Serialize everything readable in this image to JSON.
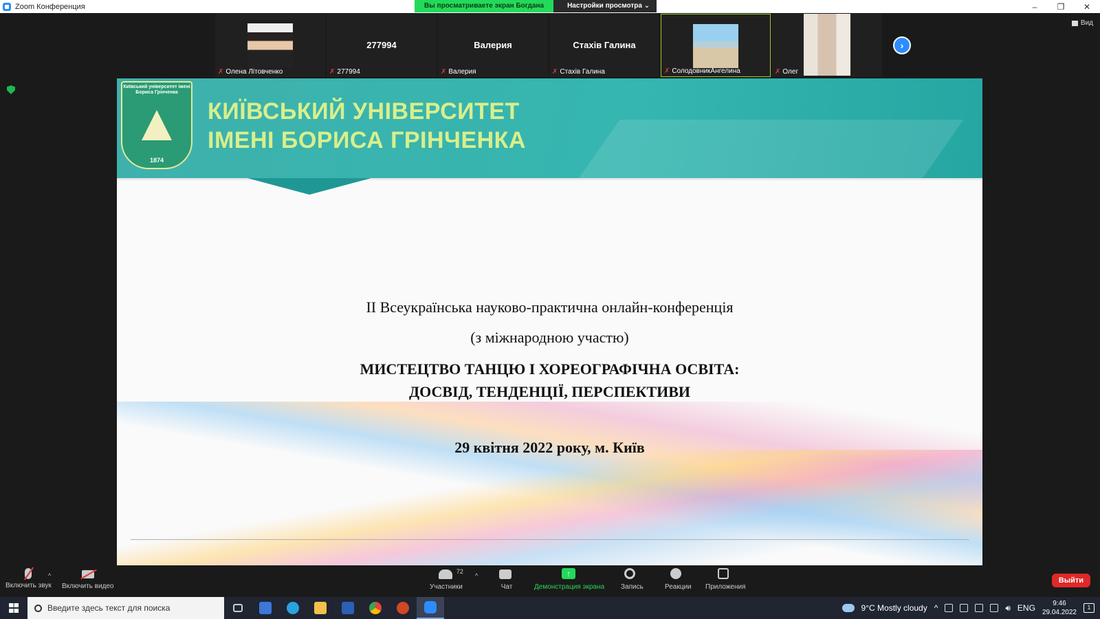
{
  "window": {
    "title": "Zoom Конференция",
    "share_status": "Вы просматриваете экран Богдана",
    "view_settings": "Настройки просмотра ⌄",
    "view_button": "Вид"
  },
  "participants_strip": [
    {
      "display": "",
      "label": "Олена Літовченко",
      "has_video": true
    },
    {
      "display": "277994",
      "label": "277994",
      "has_video": false
    },
    {
      "display": "Валерия",
      "label": "Валерия",
      "has_video": false
    },
    {
      "display": "Стахів Галина",
      "label": "Стахів Галина",
      "has_video": false
    },
    {
      "display": "",
      "label": "СолодовникАнгелина",
      "has_video": true,
      "active": true
    },
    {
      "display": "",
      "label": "Олег",
      "has_video": true
    }
  ],
  "slide": {
    "crest_text": "Київський університет імені Бориса Грінченка",
    "crest_year": "1874",
    "university_line1": "КИЇВСЬКИЙ УНІВЕРСИТЕТ",
    "university_line2": "ІМЕНІ БОРИСА ГРІНЧЕНКА",
    "line1": "ІІ Всеукраїнська науково-практична онлайн-конференція",
    "line2": "(з міжнародною участю)",
    "title_line1": "МИСТЕЦТВО ТАНЦЮ І ХОРЕОГРАФІЧНА ОСВІТА:",
    "title_line2": "ДОСВІД, ТЕНДЕНЦІЇ, ПЕРСПЕКТИВИ",
    "date_place": "29 квітня 2022 року, м. Київ"
  },
  "toolbar": {
    "unmute": "Включить звук",
    "start_video": "Включить видео",
    "participants": "Участники",
    "participants_count": "72",
    "chat": "Чат",
    "share_screen": "Демонстрация экрана",
    "record": "Запись",
    "reactions": "Реакции",
    "apps": "Приложения",
    "leave": "Выйти"
  },
  "taskbar": {
    "search_placeholder": "Введите здесь текст для поиска",
    "weather": "9°C  Mostly cloudy",
    "language": "ENG",
    "time": "9:46",
    "date": "29.04.2022",
    "notifications": "1"
  },
  "colors": {
    "zoom_blue": "#2d8cff",
    "share_green": "#23d959",
    "leave_red": "#e02828",
    "slide_teal": "#35b6b0",
    "uni_title_green": "#d8ef8c"
  }
}
